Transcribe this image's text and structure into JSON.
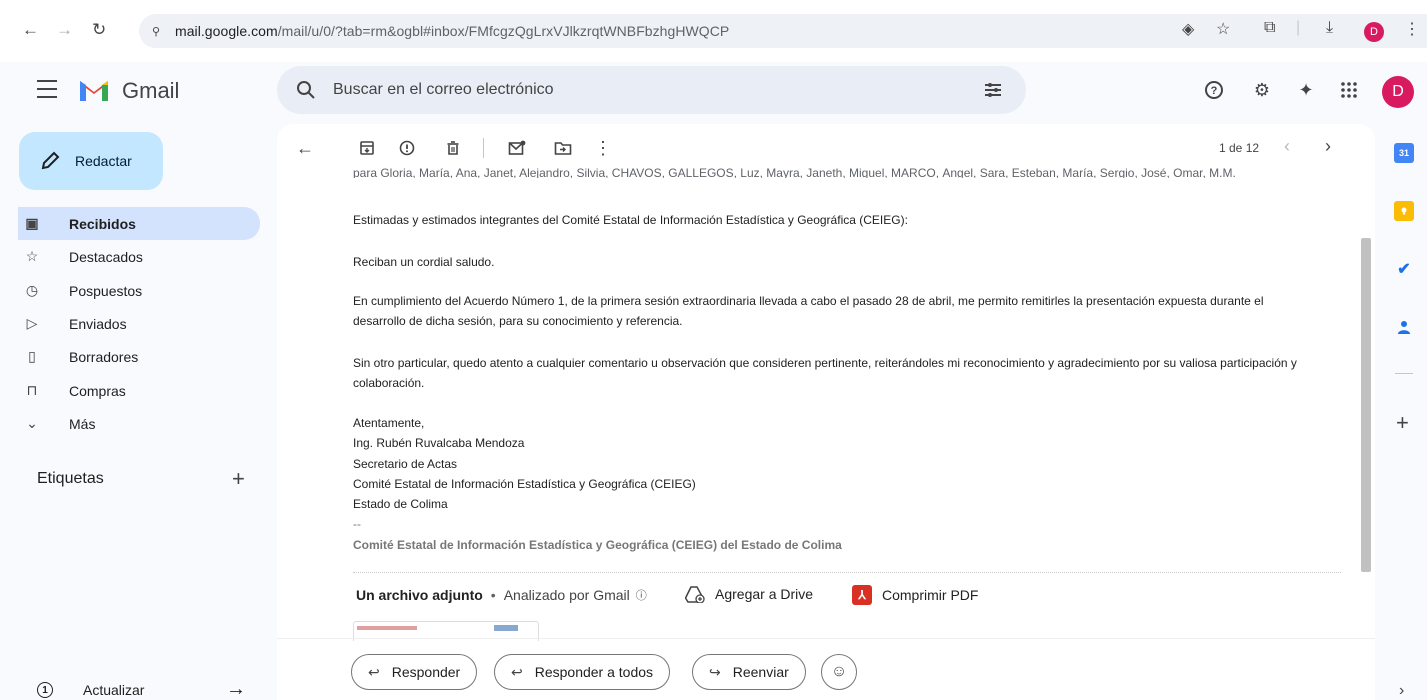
{
  "browser": {
    "url_host": "mail.google.com",
    "url_path": "/mail/u/0/?tab=rm&ogbl#inbox/FMfcgzQgLrxVJlkzrqtWNBFbzhgHWQCP",
    "profile_initial": "D"
  },
  "header": {
    "app_name": "Gmail",
    "search_placeholder": "Buscar en el correo electrónico",
    "avatar_initial": "D"
  },
  "sidebar": {
    "compose_label": "Redactar",
    "items": [
      {
        "label": "Recibidos",
        "icon": "inbox-icon"
      },
      {
        "label": "Destacados",
        "icon": "star-icon"
      },
      {
        "label": "Pospuestos",
        "icon": "clock-icon"
      },
      {
        "label": "Enviados",
        "icon": "send-icon"
      },
      {
        "label": "Borradores",
        "icon": "draft-icon"
      },
      {
        "label": "Compras",
        "icon": "shopping-icon"
      },
      {
        "label": "Más",
        "icon": "chevron-down-icon"
      }
    ],
    "labels_heading": "Etiquetas",
    "update_label": "Actualizar",
    "update_count": "1"
  },
  "toolbar": {
    "pager_text": "1 de 12"
  },
  "email": {
    "recipients": "para Gloria, María, Ana, Janet, Alejandro, Silvia, CHAVOS, GALLEGOS, Luz, Mayra, Janeth, Miguel, MARCO, Ángel, Sara, Esteban, María, Sergio, José, Omar, M.M.",
    "greeting": "Estimadas y estimados integrantes del Comité Estatal de Información Estadística y Geográfica (CEIEG):",
    "salutation": "Reciban un cordial saludo.",
    "paragraph1": "En cumplimiento del Acuerdo Número 1, de la primera sesión extraordinaria llevada a cabo el pasado 28  de abril, me permito remitirles la presentación expuesta durante el desarrollo de dicha sesión, para su conocimiento y referencia.",
    "paragraph2": "Sin otro particular, quedo atento a cualquier comentario u observación que consideren pertinente, reiterándoles mi reconocimiento y agradecimiento por su valiosa participación y colaboración.",
    "signature_lines": [
      "Atentamente,",
      "Ing. Rubén Ruvalcaba Mendoza",
      "Secretario de Actas",
      "Comité Estatal de Información Estadística y Geográfica (CEIEG)",
      "Estado de Colima",
      "--"
    ],
    "footer": "Comité Estatal de Información Estadística y Geográfica (CEIEG) del Estado de Colima"
  },
  "attachments": {
    "title": "Un archivo adjunto",
    "separator": "•",
    "scan_text": "Analizado por Gmail",
    "drive_label": "Agregar a Drive",
    "pdf_label": "Comprimir PDF"
  },
  "actions": {
    "reply": "Responder",
    "reply_all": "Responder a todos",
    "forward": "Reenviar"
  },
  "right_rail": {
    "calendar_day": "31"
  },
  "colors": {
    "compose_bg": "#c2e7ff",
    "active_nav_bg": "#d3e3fd",
    "avatar": "#d81b60",
    "pdf_red": "#d93025"
  }
}
